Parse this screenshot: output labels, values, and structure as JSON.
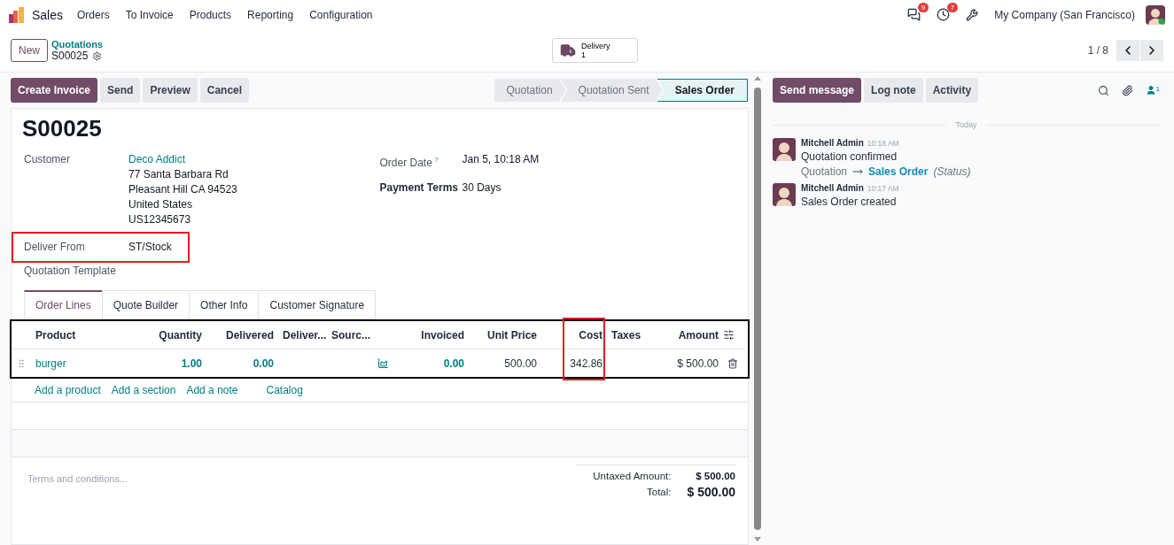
{
  "app": {
    "name": "Sales"
  },
  "menu": [
    "Orders",
    "To Invoice",
    "Products",
    "Reporting",
    "Configuration"
  ],
  "systray": {
    "messages_badge": "9",
    "activities_badge": "7",
    "company": "My Company (San Francisco)"
  },
  "control_panel": {
    "new_button": "New",
    "breadcrumb": "Quotations",
    "record": "S00025",
    "smart_button": {
      "label": "Delivery",
      "count": "1"
    },
    "pager": "1 / 8"
  },
  "actions": [
    {
      "label": "Create Invoice",
      "primary": true
    },
    {
      "label": "Send",
      "primary": false
    },
    {
      "label": "Preview",
      "primary": false
    },
    {
      "label": "Cancel",
      "primary": false
    }
  ],
  "status_steps": [
    {
      "label": "Quotation",
      "selected": false
    },
    {
      "label": "Quotation Sent",
      "selected": false
    },
    {
      "label": "Sales Order",
      "selected": true
    }
  ],
  "form": {
    "title": "S00025",
    "left_fields": [
      {
        "label": "Customer",
        "required": false,
        "value": "Deco Addict",
        "kind": "link",
        "lines": [
          "77 Santa Barbara Rd",
          "Pleasant Hill CA 94523",
          "United States",
          "US12345673"
        ]
      },
      {
        "label": "Deliver From",
        "required": false,
        "highlighted": true,
        "value": "ST/Stock",
        "kind": "text"
      },
      {
        "label": "Quotation Template",
        "required": false
      }
    ],
    "right_fields": [
      {
        "label": "Order Date",
        "help": "?",
        "required": false,
        "value": "Jan 5, 10:18 AM"
      },
      {
        "label": "Payment Terms",
        "required": true,
        "value": "30 Days"
      }
    ]
  },
  "tabs": [
    {
      "label": "Order Lines",
      "selected": true
    },
    {
      "label": "Quote Builder",
      "selected": false
    },
    {
      "label": "Other Info",
      "selected": false
    },
    {
      "label": "Customer Signature",
      "selected": false
    }
  ],
  "table": {
    "highlighted": true,
    "columns": [
      {
        "label": "Product"
      },
      {
        "label": "Quantity"
      },
      {
        "label": "Delivered"
      },
      {
        "label": "Deliver..."
      },
      {
        "label": "Sourc..."
      },
      {},
      {
        "label": "Invoiced"
      },
      {
        "label": "Unit Price"
      },
      {
        "label": "Cost",
        "highlighted": true
      },
      {
        "label": "Taxes"
      },
      {
        "label": "Amount"
      }
    ],
    "rows": [
      {
        "cells": [
          {
            "kind": "link",
            "text": "burger"
          },
          {
            "kind": "number",
            "text": "1.00"
          },
          {
            "kind": "number",
            "text": "0.00"
          },
          {
            "kind": "empty"
          },
          {
            "kind": "empty"
          },
          {
            "kind": "forecast"
          },
          {
            "kind": "number",
            "text": "0.00"
          },
          {
            "kind": "text",
            "text": "500.00"
          },
          {
            "kind": "text",
            "text": "342.86"
          },
          {
            "kind": "empty"
          },
          {
            "kind": "text",
            "text": "$ 500.00"
          }
        ]
      }
    ],
    "add_links": [
      "Add a product",
      "Add a section",
      "Add a note",
      "Catalog"
    ]
  },
  "terms": {
    "placeholder": "Terms and conditions..."
  },
  "totals": [
    {
      "label": "Untaxed Amount:",
      "value": "$ 500.00",
      "grand": false
    },
    {
      "label": "Total:",
      "value": "$ 500.00",
      "grand": true
    }
  ],
  "chatter": {
    "buttons": [
      {
        "label": "Send message",
        "primary": true
      },
      {
        "label": "Log note",
        "primary": false
      },
      {
        "label": "Activity",
        "primary": false
      }
    ],
    "followers_count": "1",
    "divider": "Today",
    "messages": [
      {
        "author": "Mitchell Admin",
        "time": "10:18 AM",
        "body": "Quotation confirmed",
        "tracking": {
          "from": "Quotation",
          "to": "Sales Order",
          "field": "(Status)"
        }
      },
      {
        "author": "Mitchell Admin",
        "time": "10:17 AM",
        "body": "Sales Order created"
      }
    ]
  }
}
